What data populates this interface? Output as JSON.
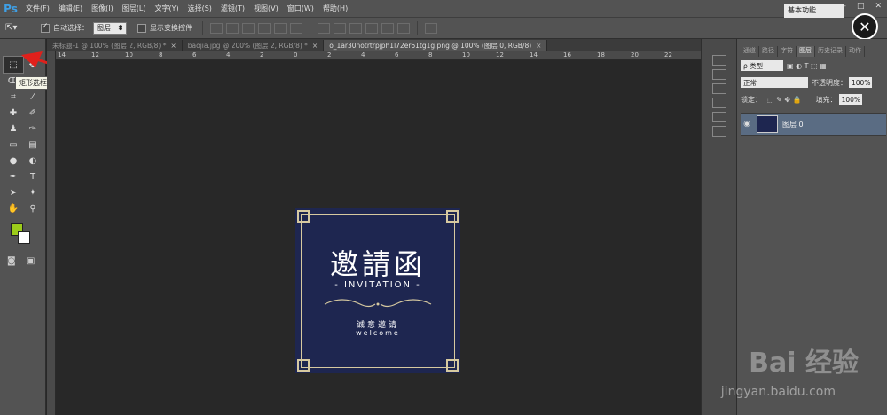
{
  "app": {
    "logo": "Ps"
  },
  "menu": [
    "文件(F)",
    "编辑(E)",
    "图像(I)",
    "图层(L)",
    "文字(Y)",
    "选择(S)",
    "滤镜(T)",
    "视图(V)",
    "窗口(W)",
    "帮助(H)"
  ],
  "window_controls": {
    "minimize": "—",
    "restore": "□",
    "close": "✕"
  },
  "options": {
    "auto_select_label": "自动选择：",
    "auto_select_value": "图层",
    "show_transform_label": "显示变换控件",
    "workspace": "基本功能"
  },
  "tooltip": "矩形选框工具 (M)",
  "tabs": [
    {
      "label": "未标题-1 @ 100% (图层 2, RGB/8) *",
      "active": false
    },
    {
      "label": "baojia.jpg @ 200% (图层 2, RGB/8) *",
      "active": false
    },
    {
      "label": "o_1ar30notrtrpjph1l72er61tg1g.png @ 100% (图层 0, RGB/8)",
      "active": true
    }
  ],
  "ruler_labels": [
    "14",
    "12",
    "10",
    "8",
    "6",
    "4",
    "2",
    "0",
    "2",
    "4",
    "6",
    "8",
    "10",
    "12",
    "14",
    "16",
    "18",
    "20",
    "22"
  ],
  "document": {
    "title": "邀請函",
    "invitation": "- INVITATION -",
    "subtitle": "诚意邀请",
    "welcome": "welcome",
    "colors": {
      "background": "#1e2650",
      "ornament": "#d6c9a0"
    }
  },
  "panel": {
    "tabs": [
      "通道",
      "路径",
      "字符",
      "图层",
      "历史记录",
      "动作"
    ],
    "kind_filter": "ρ 类型",
    "blend_mode": "正常",
    "opacity_label": "不透明度：",
    "opacity_value": "100%",
    "lock_label": "锁定：",
    "fill_label": "填充：",
    "fill_value": "100%",
    "layer_name": "图层 0"
  },
  "watermark": {
    "brand": "Bai 经验",
    "url": "jingyan.baidu.com"
  },
  "colors": {
    "foreground": "#9ccc1a",
    "background": "#ffffff",
    "accent": "#3fa0e6"
  }
}
